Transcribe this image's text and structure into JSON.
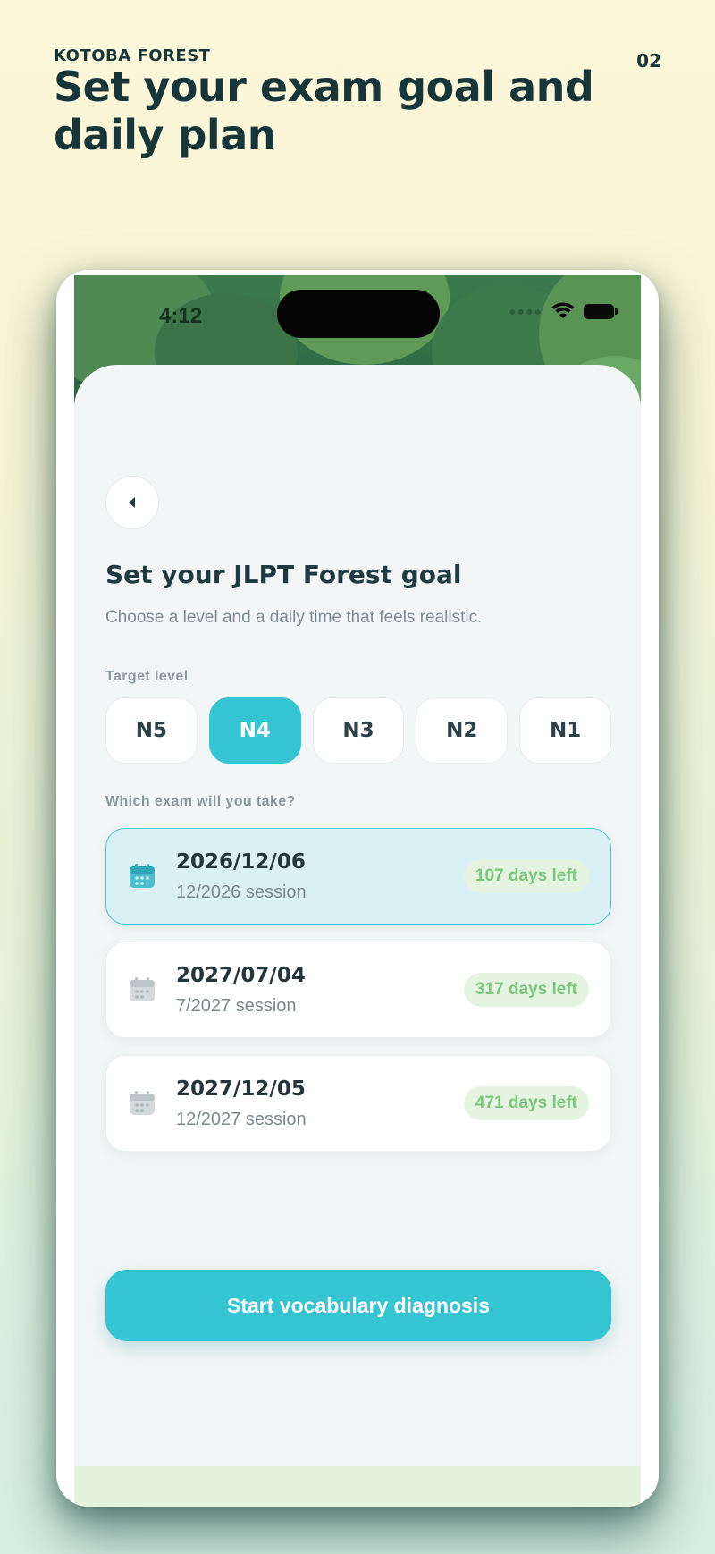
{
  "header": {
    "brand": "KOTOBA FOREST",
    "headline": "Set your exam goal and daily plan",
    "page_number": "02"
  },
  "status_bar": {
    "time": "4:12",
    "icons": [
      "signal-icon",
      "wifi-icon",
      "battery-icon"
    ]
  },
  "screen": {
    "title": "Set your JLPT Forest goal",
    "subtitle": "Choose a level and a daily time that feels realistic.",
    "target_level_label": "Target level",
    "levels": [
      {
        "label": "N5",
        "selected": false
      },
      {
        "label": "N4",
        "selected": true
      },
      {
        "label": "N3",
        "selected": false
      },
      {
        "label": "N2",
        "selected": false
      },
      {
        "label": "N1",
        "selected": false
      }
    ],
    "exam_label": "Which exam will you take?",
    "exams": [
      {
        "date": "2026/12/06",
        "session": "12/2026 session",
        "days_left": "107 days left",
        "selected": true
      },
      {
        "date": "2027/07/04",
        "session": "7/2027 session",
        "days_left": "317 days left",
        "selected": false
      },
      {
        "date": "2027/12/05",
        "session": "12/2027 session",
        "days_left": "471 days left",
        "selected": false
      }
    ],
    "cta_label": "Start vocabulary diagnosis"
  },
  "colors": {
    "accent": "#35c4d2",
    "heading": "#17363a",
    "badge_bg": "#e4f4e0",
    "badge_text": "#7bc57e",
    "selected_card": "#d9f1f4"
  }
}
